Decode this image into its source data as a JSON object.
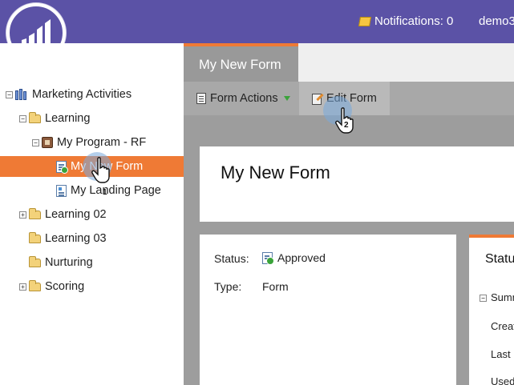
{
  "header": {
    "notifications_label": "Notifications: 0",
    "user_label": "demo3",
    "bg_color": "#5b52a6"
  },
  "logo": {
    "icon": "marketo-logo-icon"
  },
  "sidebar": {
    "items": [
      {
        "label": "Marketing Activities",
        "icon": "books-icon",
        "expander": "−",
        "level": 0
      },
      {
        "label": "Learning",
        "icon": "folder-icon",
        "expander": "−",
        "level": 1
      },
      {
        "label": "My Program - RF",
        "icon": "program-icon",
        "expander": "−",
        "level": 2
      },
      {
        "label": "My New Form",
        "icon": "form-icon",
        "expander": "",
        "level": 3,
        "selected": true
      },
      {
        "label": "My Landing Page",
        "icon": "landing-page-icon",
        "expander": "",
        "level": 3
      },
      {
        "label": "Learning 02",
        "icon": "folder-icon",
        "expander": "+",
        "level": 1
      },
      {
        "label": "Learning 03",
        "icon": "folder-icon",
        "expander": "",
        "level": 1
      },
      {
        "label": "Nurturing",
        "icon": "folder-icon",
        "expander": "",
        "level": 1
      },
      {
        "label": "Scoring",
        "icon": "folder-icon",
        "expander": "+",
        "level": 1
      }
    ],
    "selected_color": "#ef7a35"
  },
  "main": {
    "tab_label": "My New Form",
    "toolbar": {
      "form_actions_label": "Form Actions",
      "edit_form_label": "Edit Form"
    },
    "title": "My New Form",
    "details": {
      "status_label": "Status:",
      "status_value": "Approved",
      "type_label": "Type:",
      "type_value": "Form"
    },
    "status_panel": {
      "title": "Status",
      "summary_label": "Summary",
      "created_label": "Created",
      "last_label": "Last",
      "used_label": "Used"
    },
    "accent_color": "#ef7a35"
  },
  "annotations": {
    "step1_number": "1",
    "step2_number": "2"
  }
}
